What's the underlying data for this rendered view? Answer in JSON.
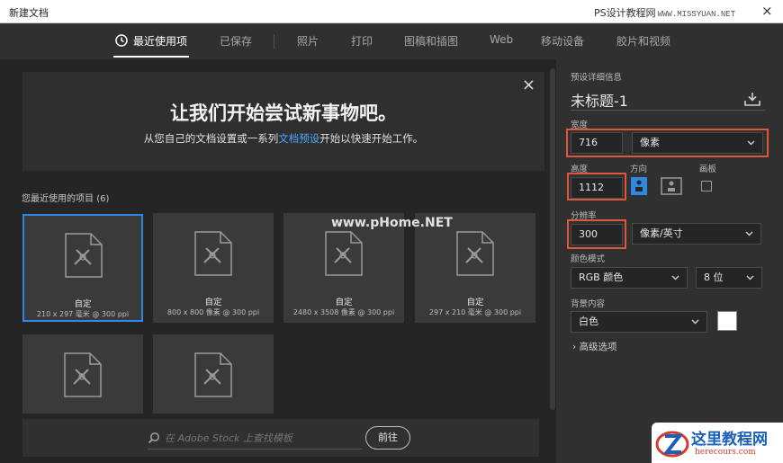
{
  "window": {
    "title": "新建文档",
    "watermark_site": "PS设计教程网",
    "watermark_url": "WWW.MISSYUAN.NET",
    "close_label": "×"
  },
  "tabs": [
    {
      "label": "最近使用项",
      "active": true
    },
    {
      "label": "已保存"
    },
    {
      "label": "照片"
    },
    {
      "label": "打印"
    },
    {
      "label": "图稿和插图"
    },
    {
      "label": "Web"
    },
    {
      "label": "移动设备"
    },
    {
      "label": "胶片和视频"
    }
  ],
  "banner": {
    "heading": "让我们开始尝试新事物吧。",
    "sub_before": "从您自己的文档设置或一系列",
    "sub_link": "文档预设",
    "sub_after": "开始以快速开始工作。",
    "close_label": "×"
  },
  "recent": {
    "label": "您最近使用的项目",
    "count": "(6)",
    "items": [
      {
        "name": "自定",
        "dims": "210 x 297 毫米 @ 300 ppi"
      },
      {
        "name": "自定",
        "dims": "800 x 800 像素 @ 300 ppi"
      },
      {
        "name": "自定",
        "dims": "2480 x 3508 像素 @ 300 ppi"
      },
      {
        "name": "自定",
        "dims": "297 x 210 毫米 @ 300 ppi"
      },
      {
        "name": "",
        "dims": ""
      },
      {
        "name": "",
        "dims": ""
      }
    ]
  },
  "stock": {
    "placeholder": "在 Adobe Stock 上查找模板",
    "go_label": "前往"
  },
  "details": {
    "header": "预设详细信息",
    "doc_title": "未标题-1",
    "width_label": "宽度",
    "width_value": "716",
    "width_unit": "像素",
    "height_label": "高度",
    "height_value": "1112",
    "orientation_label": "方向",
    "artboard_label": "画板",
    "resolution_label": "分辨率",
    "resolution_value": "300",
    "resolution_unit": "像素/英寸",
    "color_mode_label": "颜色模式",
    "color_mode": "RGB 颜色",
    "bit_depth": "8 位",
    "background_label": "背景内容",
    "background": "白色",
    "advanced_label": "高级选项"
  },
  "watermarks": {
    "center": "www.pHome.NET",
    "logo_cn": "这里教程网",
    "logo_en": "herecours.com"
  },
  "colors": {
    "accent": "#2f88e6",
    "highlight": "#e0563b",
    "link": "#4aa8ff"
  }
}
